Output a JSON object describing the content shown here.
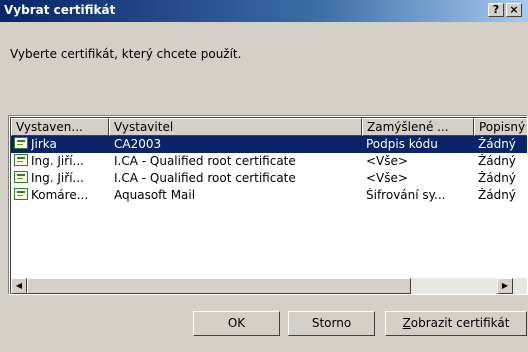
{
  "window": {
    "title": "Vybrat certifikát",
    "help_label": "?",
    "close_label": "×"
  },
  "prompt": "Vyberte certifikát, který chcete použít.",
  "list": {
    "columns": [
      "Vystaven...",
      "Vystavitel",
      "Zamýšlené ...",
      "Popisný"
    ],
    "rows": [
      {
        "issued_to": "Jirka",
        "issuer": "CA2003",
        "purpose": "Podpis kódu",
        "friendly": "Žádný",
        "selected": true
      },
      {
        "issued_to": "Ing. Jiří...",
        "issuer": "I.CA - Qualified root certificate",
        "purpose": "<Vše>",
        "friendly": "Žádný",
        "selected": false
      },
      {
        "issued_to": "Ing. Jiří...",
        "issuer": "I.CA - Qualified root certificate",
        "purpose": "<Vše>",
        "friendly": "Žádný",
        "selected": false
      },
      {
        "issued_to": "Komáre...",
        "issuer": "Aquasoft Mail",
        "purpose": "Šifrování sy...",
        "friendly": "Žádný",
        "selected": false
      }
    ]
  },
  "buttons": {
    "ok": "OK",
    "cancel": "Storno",
    "view_accel": "Z",
    "view_rest": "obrazit certifikát"
  },
  "colors": {
    "title_gradient_start": "#0a246a",
    "selection": "#0a246a",
    "dialog_face": "#d4d0c8"
  }
}
